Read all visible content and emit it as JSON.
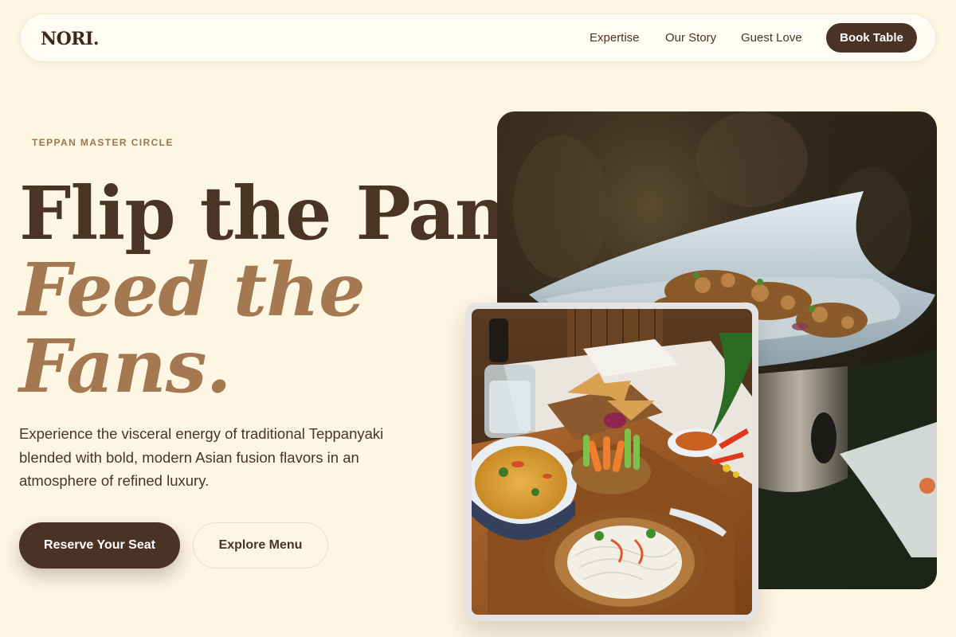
{
  "nav": {
    "brand": "NORI.",
    "links": [
      "Expertise",
      "Our Story",
      "Guest Love"
    ],
    "book_label": "Book Table"
  },
  "hero": {
    "eyebrow": "TEPPAN MASTER CIRCLE",
    "headline_line1": "Flip the Pan,",
    "headline_line2": "Feed the",
    "headline_line3": "Fans.",
    "description": "Experience the visceral energy of traditional Teppanyaki blended with bold, modern Asian fusion flavors in an atmosphere of refined luxury.",
    "primary_cta": "Reserve Your Seat",
    "secondary_cta": "Explore Menu"
  },
  "colors": {
    "background": "#fdf6e2",
    "accent_dark": "#4a3324",
    "accent_gold": "#a47952"
  },
  "images": {
    "main": "teppanyaki-dish-photo",
    "secondary": "asian-food-platter-photo"
  }
}
